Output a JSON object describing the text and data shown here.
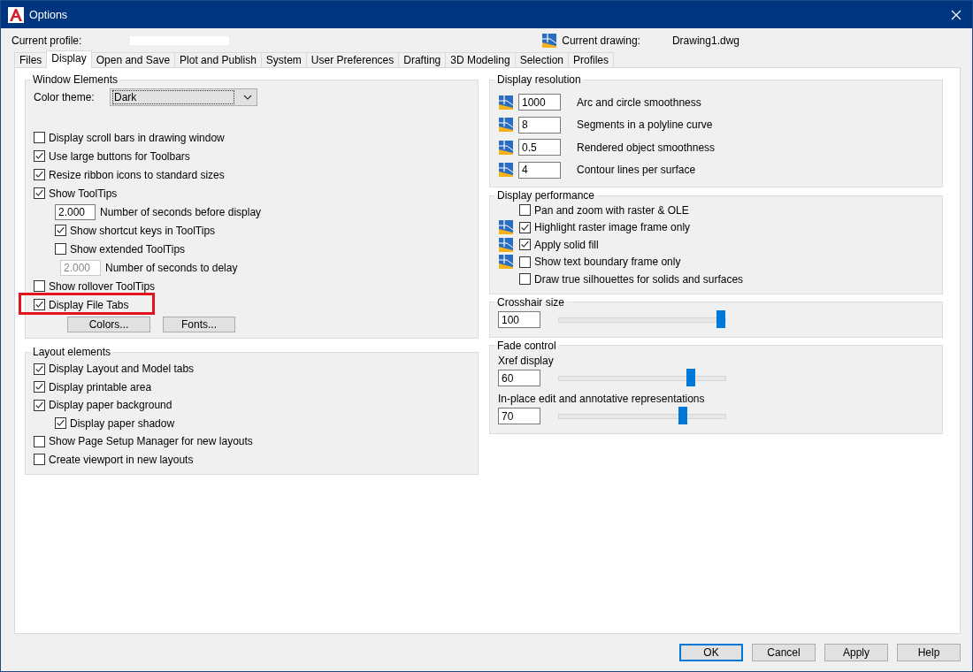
{
  "window": {
    "title": "Options"
  },
  "header": {
    "profile_label": "Current profile:",
    "drawing_label": "Current drawing:",
    "drawing_name": "Drawing1.dwg"
  },
  "tabs": [
    {
      "label": "Files",
      "selected": false
    },
    {
      "label": "Display",
      "selected": true
    },
    {
      "label": "Open and Save",
      "selected": false
    },
    {
      "label": "Plot and Publish",
      "selected": false
    },
    {
      "label": "System",
      "selected": false
    },
    {
      "label": "User Preferences",
      "selected": false
    },
    {
      "label": "Drafting",
      "selected": false
    },
    {
      "label": "3D Modeling",
      "selected": false
    },
    {
      "label": "Selection",
      "selected": false
    },
    {
      "label": "Profiles",
      "selected": false
    }
  ],
  "window_elements": {
    "title": "Window Elements",
    "color_theme": {
      "label": "Color theme:",
      "value": "Dark"
    },
    "options": [
      {
        "kind": "checkbox",
        "label": "Display scroll bars in drawing window",
        "checked": false
      },
      {
        "kind": "checkbox",
        "label": "Use large buttons for Toolbars",
        "checked": true
      },
      {
        "kind": "checkbox",
        "label": "Resize ribbon icons to standard sizes",
        "checked": true
      },
      {
        "kind": "checkbox",
        "label": "Show ToolTips",
        "checked": true,
        "children": [
          {
            "kind": "number",
            "value": "2.000",
            "label": "Number of seconds before display",
            "disabled": false
          },
          {
            "kind": "checkbox",
            "label": "Show shortcut keys in ToolTips",
            "checked": true
          },
          {
            "kind": "checkbox",
            "label": "Show extended ToolTips",
            "checked": false,
            "children": [
              {
                "kind": "number",
                "value": "2.000",
                "label": "Number of seconds to delay",
                "disabled": true
              }
            ]
          }
        ]
      },
      {
        "kind": "checkbox",
        "label": "Show rollover ToolTips",
        "checked": false
      },
      {
        "kind": "checkbox",
        "label": "Display File Tabs",
        "checked": true,
        "highlighted": true
      }
    ],
    "buttons": [
      "Colors...",
      "Fonts..."
    ]
  },
  "layout_elements": {
    "title": "Layout elements",
    "options": [
      {
        "kind": "checkbox",
        "label": "Display Layout and Model tabs",
        "checked": true
      },
      {
        "kind": "checkbox",
        "label": "Display printable area",
        "checked": true
      },
      {
        "kind": "checkbox",
        "label": "Display paper background",
        "checked": true,
        "children": [
          {
            "kind": "checkbox",
            "label": "Display paper shadow",
            "checked": true
          }
        ]
      },
      {
        "kind": "checkbox",
        "label": "Show Page Setup Manager for new layouts",
        "checked": false
      },
      {
        "kind": "checkbox",
        "label": "Create viewport in new layouts",
        "checked": false
      }
    ]
  },
  "display_resolution": {
    "title": "Display resolution",
    "rows": [
      {
        "value": "1000",
        "label": "Arc and circle smoothness"
      },
      {
        "value": "8",
        "label": "Segments in a polyline curve"
      },
      {
        "value": "0.5",
        "label": "Rendered object smoothness"
      },
      {
        "value": "4",
        "label": "Contour lines per surface"
      }
    ]
  },
  "display_performance": {
    "title": "Display performance",
    "rows": [
      {
        "label": "Pan and zoom with raster & OLE",
        "checked": false,
        "saved_in_drawing": false
      },
      {
        "label": "Highlight raster image frame only",
        "checked": true,
        "saved_in_drawing": true
      },
      {
        "label": "Apply solid fill",
        "checked": true,
        "saved_in_drawing": true
      },
      {
        "label": "Show text boundary frame only",
        "checked": false,
        "saved_in_drawing": true
      },
      {
        "label": "Draw true silhouettes for solids and surfaces",
        "checked": false,
        "saved_in_drawing": false
      }
    ]
  },
  "crosshair_size": {
    "title": "Crosshair size",
    "value": "100",
    "level": 1.0
  },
  "fade_control": {
    "title": "Fade control",
    "sliders": [
      {
        "label": "Xref display",
        "value": "60",
        "level": 0.81
      },
      {
        "label": "In-place edit and annotative representations",
        "value": "70",
        "level": 0.76
      }
    ]
  },
  "buttons": [
    {
      "label": "OK",
      "default": true
    },
    {
      "label": "Cancel",
      "default": false
    },
    {
      "label": "Apply",
      "default": false
    },
    {
      "label": "Help",
      "default": false
    }
  ]
}
